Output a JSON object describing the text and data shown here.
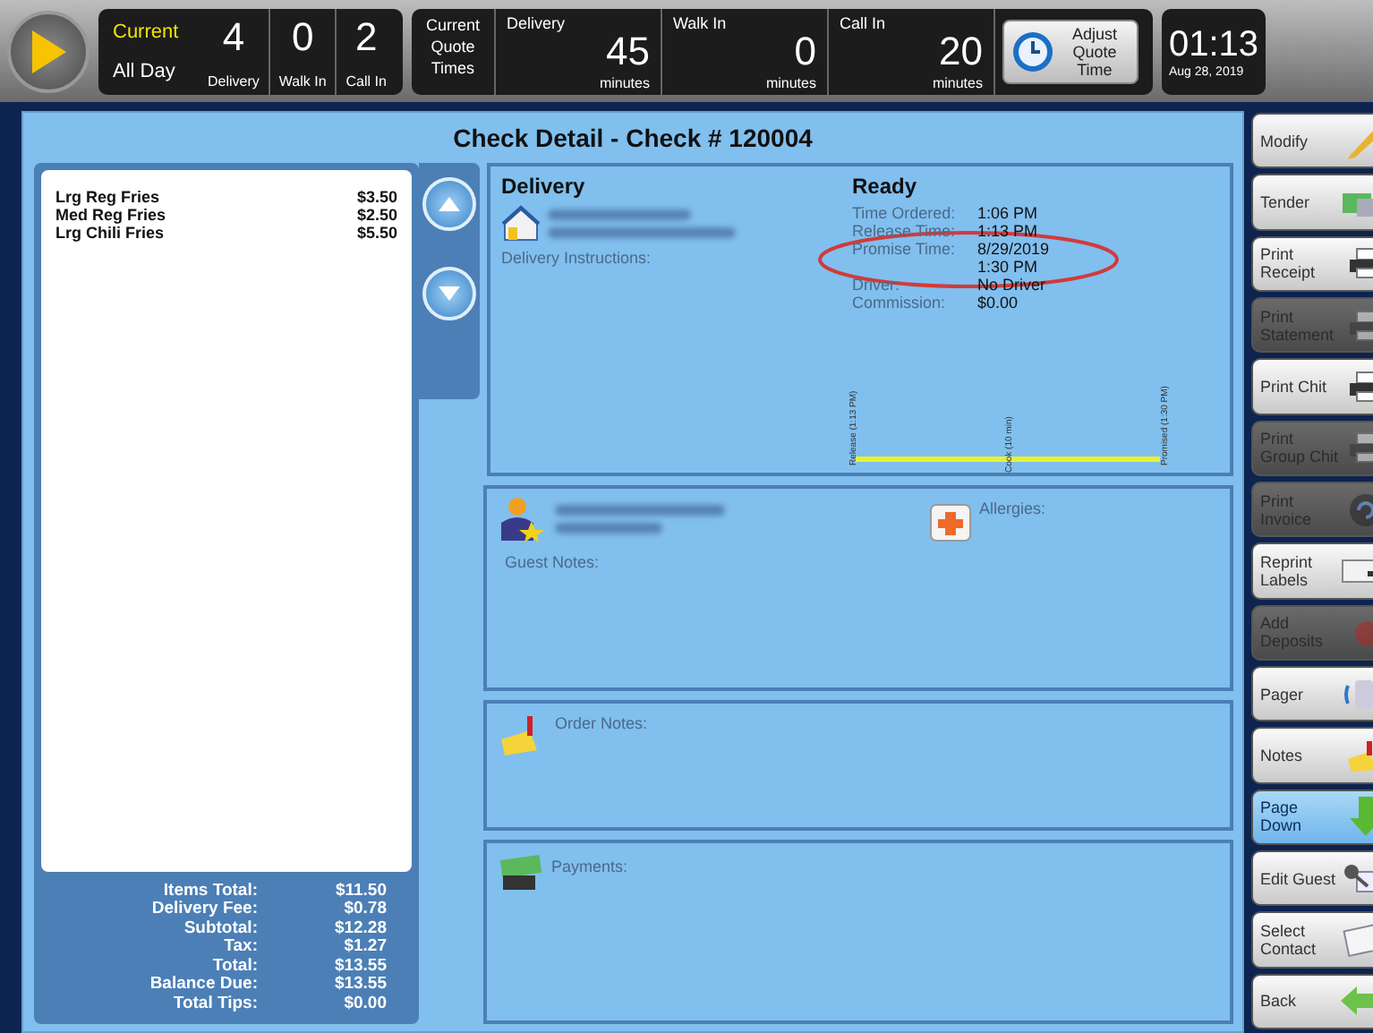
{
  "top_bar": {
    "period": {
      "label": "Current",
      "value": "All Day"
    },
    "counts": [
      {
        "value": "4",
        "label": "Delivery"
      },
      {
        "value": "0",
        "label": "Walk In"
      },
      {
        "value": "2",
        "label": "Call In"
      }
    ],
    "quote_times": {
      "label": "Current Quote Times",
      "items": [
        {
          "label": "Delivery",
          "value": "45",
          "unit": "minutes"
        },
        {
          "label": "Walk In",
          "value": "0",
          "unit": "minutes"
        },
        {
          "label": "Call In",
          "value": "20",
          "unit": "minutes"
        }
      ],
      "adjust_button": "Adjust Quote Time"
    },
    "clock": {
      "time": "01:13",
      "date": "Aug 28, 2019"
    }
  },
  "check": {
    "title": "Check Detail - Check # 120004",
    "items": [
      {
        "name": "Lrg Reg Fries",
        "price": "$3.50"
      },
      {
        "name": "Med Reg Fries",
        "price": "$2.50"
      },
      {
        "name": "Lrg Chili Fries",
        "price": "$5.50"
      }
    ],
    "totals": [
      {
        "label": "Items Total:",
        "value": "$11.50"
      },
      {
        "label": "Delivery Fee:",
        "value": "$0.78"
      },
      {
        "label": "Subtotal:",
        "value": "$12.28"
      },
      {
        "label": "Tax:",
        "value": "$1.27"
      },
      {
        "label": "Total:",
        "value": "$13.55"
      },
      {
        "label": "Balance Due:",
        "value": "$13.55"
      },
      {
        "label": "Total Tips:",
        "value": "$0.00"
      }
    ],
    "delivery": {
      "heading": "Delivery",
      "instructions_label": "Delivery Instructions:",
      "status": "Ready",
      "details": [
        {
          "label": "Time Ordered:",
          "values": [
            "1:06 PM"
          ],
          "circled": false
        },
        {
          "label": "Release Time:",
          "values": [
            "1:13 PM"
          ],
          "circled": false
        },
        {
          "label": "Promise Time:",
          "values": [
            "8/29/2019",
            "1:30 PM"
          ],
          "circled": true
        },
        {
          "label": "Driver:",
          "values": [
            "No Driver"
          ],
          "circled": false
        },
        {
          "label": "Commission:",
          "values": [
            "$0.00"
          ],
          "circled": false
        }
      ],
      "timeline_marks": [
        "Release (1:13 PM)",
        "Cook (10 min)",
        "Promised (1:30 PM)"
      ]
    },
    "guest": {
      "notes_label": "Guest Notes:",
      "allergies_label": "Allergies:"
    },
    "order_notes_label": "Order Notes:",
    "payments_label": "Payments:"
  },
  "side_buttons": [
    {
      "label": "Modify",
      "disabled": false,
      "selected": false
    },
    {
      "label": "Tender",
      "disabled": false,
      "selected": false
    },
    {
      "label": "Print Receipt",
      "disabled": false,
      "selected": false
    },
    {
      "label": "Print Statement",
      "disabled": true,
      "selected": false
    },
    {
      "label": "Print Chit",
      "disabled": false,
      "selected": false
    },
    {
      "label": "Print Group Chit",
      "disabled": true,
      "selected": false
    },
    {
      "label": "Print Invoice",
      "disabled": true,
      "selected": false
    },
    {
      "label": "Reprint Labels",
      "disabled": false,
      "selected": false
    },
    {
      "label": "Add Deposits",
      "disabled": true,
      "selected": false
    },
    {
      "label": "Pager",
      "disabled": false,
      "selected": false
    },
    {
      "label": "Notes",
      "disabled": false,
      "selected": false
    },
    {
      "label": "Page Down",
      "disabled": false,
      "selected": true
    },
    {
      "label": "Edit Guest",
      "disabled": false,
      "selected": false
    },
    {
      "label": "Select Contact",
      "disabled": false,
      "selected": false
    },
    {
      "label": "Back",
      "disabled": false,
      "selected": false
    }
  ]
}
